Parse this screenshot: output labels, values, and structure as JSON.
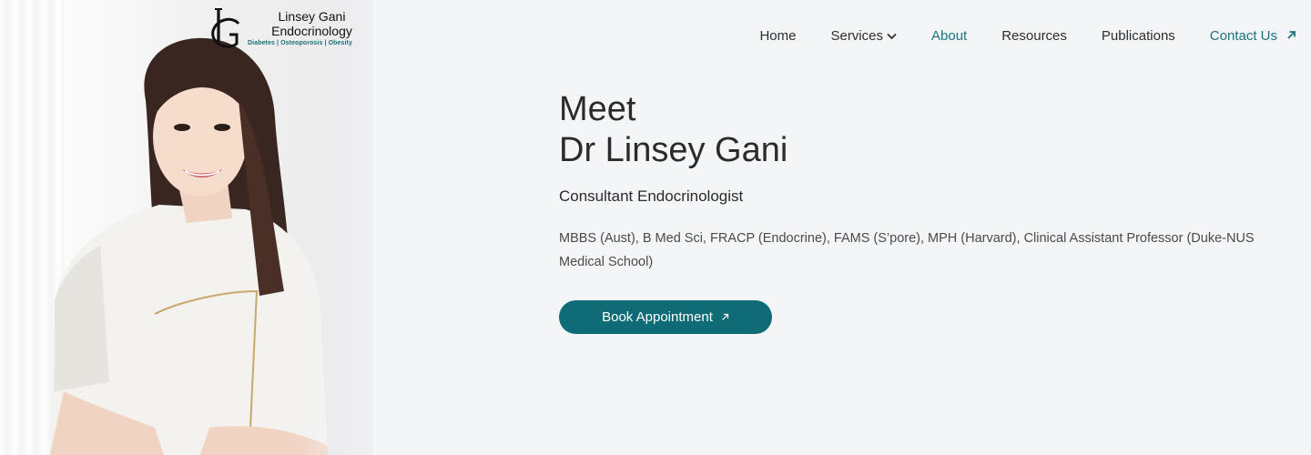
{
  "brand": {
    "name_line1": "Linsey Gani",
    "name_line2": "Endocrinology",
    "tagline": "Diabetes | Osteoporosis | Obesity",
    "monogram": "LG",
    "accent_color": "#1c7280"
  },
  "nav": {
    "items": [
      {
        "label": "Home"
      },
      {
        "label": "Services",
        "icon": "chevron-down-icon"
      },
      {
        "label": "About",
        "active": true
      },
      {
        "label": "Resources"
      },
      {
        "label": "Publications"
      },
      {
        "label": "Contact Us",
        "icon": "external-arrow-icon"
      }
    ]
  },
  "hero": {
    "title_line1": "Meet",
    "title_line2": "Dr Linsey Gani",
    "role": "Consultant Endocrinologist",
    "credentials": "MBBS (Aust), B Med Sci, FRACP (Endocrine), FAMS (S’pore), MPH (Harvard), Clinical Assistant Professor (Duke-NUS Medical School)",
    "cta_label": "Book Appointment",
    "cta_color": "#0f6b76"
  }
}
